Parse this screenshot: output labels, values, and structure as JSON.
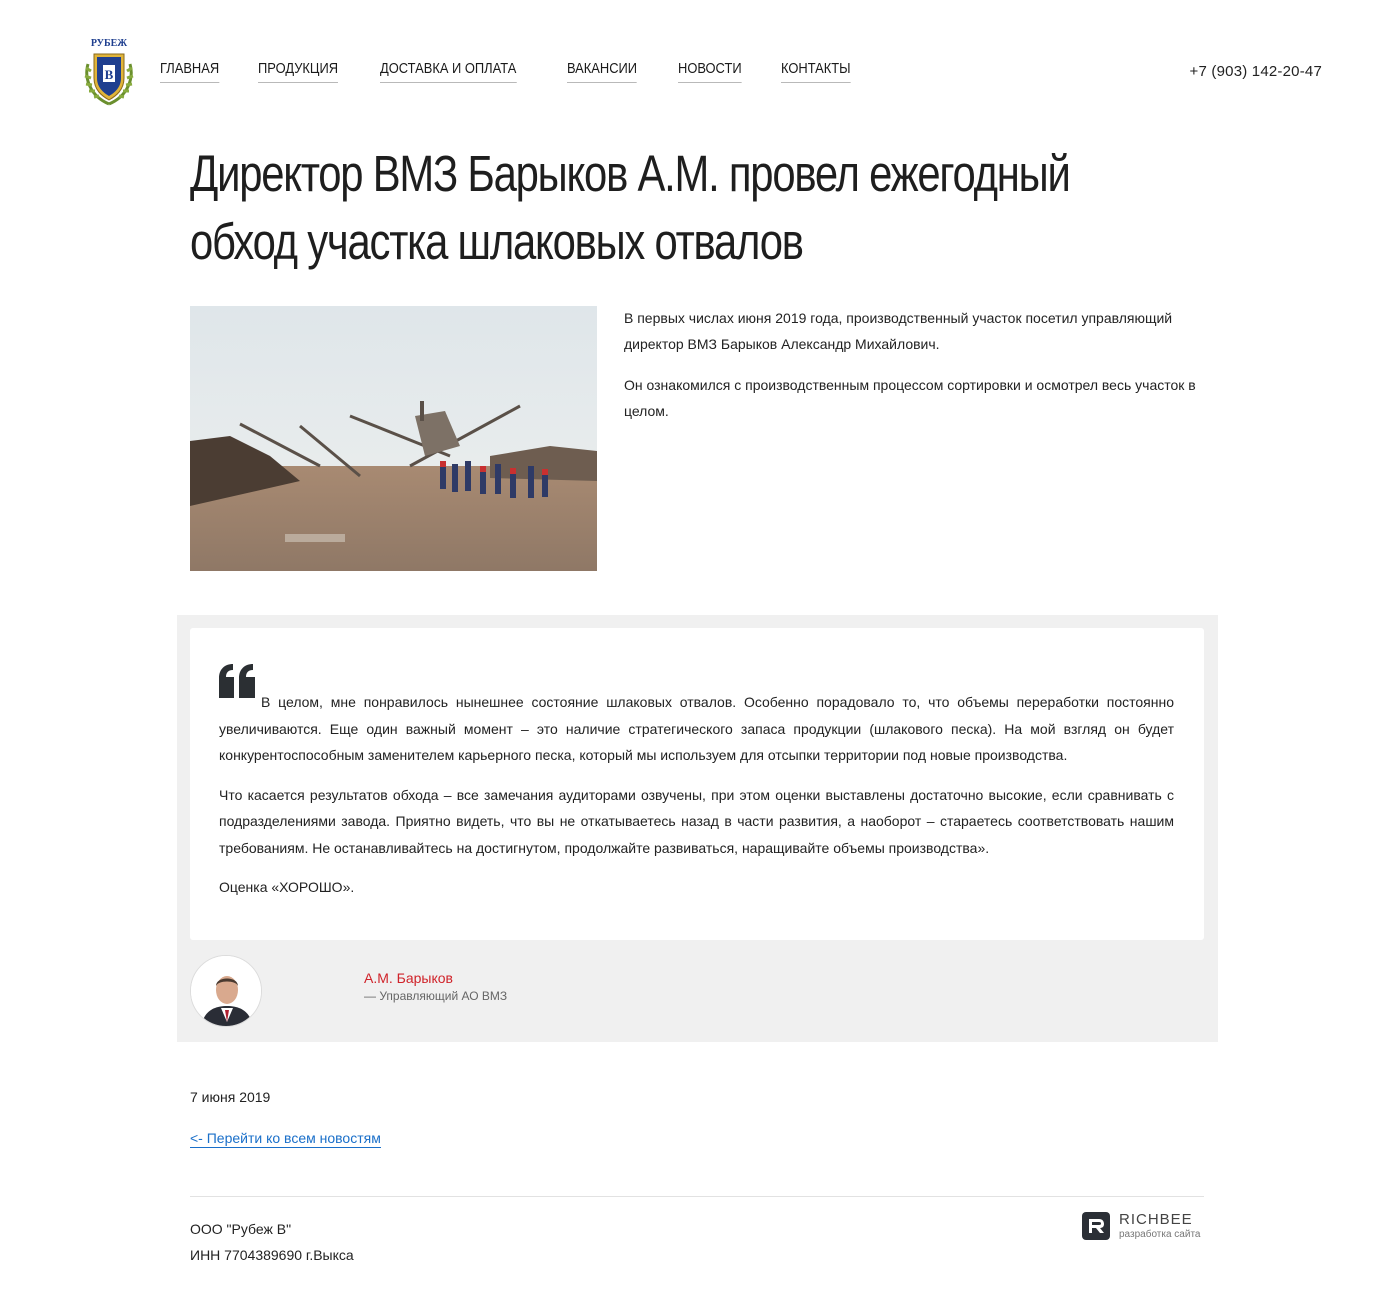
{
  "header": {
    "logo_text": "РУБЕЖ",
    "nav": [
      {
        "label": "ГЛАВНАЯ"
      },
      {
        "label": "ПРОДУКЦИЯ"
      },
      {
        "label": "ДОСТАВКА И ОПЛАТА"
      },
      {
        "label": "ВАКАНСИИ"
      },
      {
        "label": "НОВОСТИ"
      },
      {
        "label": "КОНТАКТЫ"
      }
    ],
    "phone": "+7 (903) 142-20-47"
  },
  "article": {
    "title": "Директор ВМЗ Барыков А.М. провел ежегодный обход участка шлаковых отвалов",
    "intro": [
      "В первых числах июня 2019 года, производственный участок посетил управляющий директор ВМЗ Барыков Александр Михайлович.",
      "Он ознакомился с производственным процессом сортировки и осмотрел весь участок в целом."
    ],
    "quote": [
      "В целом, мне понравилось нынешнее состояние шлаковых отвалов. Особенно порадовало то, что объемы переработки постоянно увеличиваются. Еще один важный момент – это наличие стратегического запаса продукции (шлакового песка). На мой взгляд он будет конкурентоспособным заменителем карьерного песка, который мы используем для отсыпки территории под новые производства.",
      "Что касается результатов обхода – все замечания аудиторами озвучены, при этом оценки выставлены достаточно высокие, если сравнивать с подразделениями завода. Приятно видеть, что вы не откатываетесь назад в части развития, а наоборот – стараетесь соответствовать нашим требованиям. Не останавливайтесь на достигнутом, продолжайте развиваться, наращивайте объемы производства».",
      "Оценка «ХОРОШО»."
    ],
    "author_name": "А.М. Барыков",
    "author_role": "— Управляющий АО ВМЗ",
    "date": "7 июня 2019",
    "back_link": "<- Перейти ко всем новостям"
  },
  "footer": {
    "company": "ООО \"Рубеж В\"",
    "inn": "ИНН 7704389690 г.Выкса",
    "dev_name": "RICHBEE",
    "dev_sub": "разработка сайта"
  },
  "colors": {
    "accent_red": "#d0232a",
    "link_blue": "#1a6fc9",
    "quote_bg": "#f0f0f0"
  }
}
